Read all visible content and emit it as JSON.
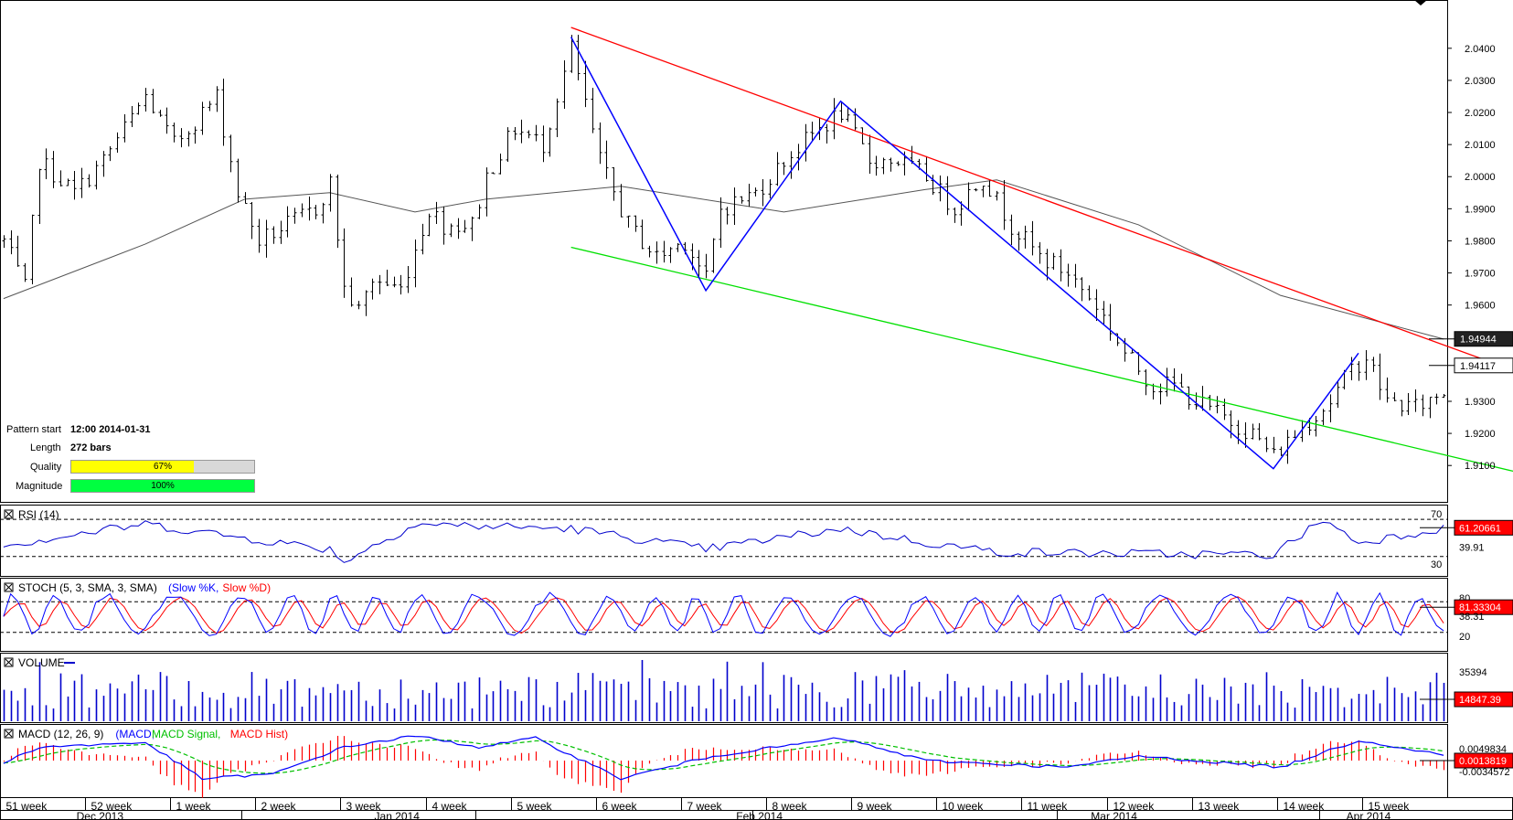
{
  "pattern": {
    "start_label": "Pattern start",
    "start_value": "12:00 2014-01-31",
    "length_label": "Length",
    "length_value": "272 bars",
    "quality_label": "Quality",
    "quality_text": "67%",
    "quality_pct": 67,
    "magnitude_label": "Magnitude",
    "magnitude_text": "100%",
    "magnitude_pct": 100
  },
  "chart_data": {
    "type": "candlestick",
    "price_axis": {
      "ticks": [
        "2.0400",
        "2.0300",
        "2.0200",
        "2.0100",
        "2.0000",
        "1.9900",
        "1.9800",
        "1.9700",
        "1.9600",
        "1.9300",
        "1.9200",
        "1.9100"
      ],
      "ylim": [
        1.9055,
        2.0465
      ],
      "tags": [
        {
          "value": 1.94944,
          "text": "1.94944"
        },
        {
          "value": 1.94117,
          "text": "1.94117"
        }
      ]
    },
    "pattern_lines": [
      {
        "color": "#ff0000",
        "from": [
          80,
          2.0465
        ],
        "to": [
          218,
          1.9355
        ]
      },
      {
        "color": "#00e000",
        "from": [
          80,
          1.978
        ],
        "to": [
          218,
          1.9055
        ]
      }
    ],
    "zigzag": {
      "color": "#0000ff",
      "points": [
        [
          80,
          2.0435
        ],
        [
          99,
          1.9645
        ],
        [
          118,
          2.0235
        ],
        [
          179,
          1.909
        ],
        [
          191,
          1.945
        ]
      ]
    },
    "moving_average": {
      "color": "#555555",
      "points": [
        [
          0,
          1.962
        ],
        [
          20,
          1.979
        ],
        [
          34,
          1.993
        ],
        [
          46,
          1.995
        ],
        [
          58,
          1.989
        ],
        [
          68,
          1.993
        ],
        [
          87,
          1.997
        ],
        [
          110,
          1.989
        ],
        [
          130,
          1.996
        ],
        [
          140,
          1.999
        ],
        [
          160,
          1.985
        ],
        [
          180,
          1.963
        ],
        [
          203,
          1.9494
        ]
      ]
    },
    "rsi": {
      "label": "RSI (14)",
      "levels": [
        70,
        30
      ],
      "tags": [
        {
          "text": "61.20661",
          "highlight": true
        },
        {
          "text": "39.91",
          "highlight": false
        }
      ],
      "anchors": [
        [
          0,
          42
        ],
        [
          20,
          65
        ],
        [
          34,
          50
        ],
        [
          46,
          38
        ],
        [
          48,
          25
        ],
        [
          58,
          65
        ],
        [
          80,
          60
        ],
        [
          99,
          38
        ],
        [
          118,
          60
        ],
        [
          130,
          45
        ],
        [
          140,
          35
        ],
        [
          160,
          33
        ],
        [
          179,
          32
        ],
        [
          186,
          70
        ],
        [
          191,
          45
        ],
        [
          203,
          61
        ]
      ]
    },
    "stoch": {
      "label": "STOCH (5, 3, SMA, 3, SMA)",
      "legend": [
        {
          "text": "Slow %K",
          "color": "#0000ff"
        },
        {
          "text": "Slow %D",
          "color": "#ff0000"
        }
      ],
      "levels": [
        80,
        20
      ],
      "tags": [
        {
          "text": "80",
          "highlight": false
        },
        {
          "text": "81.33304",
          "highlight": true
        },
        {
          "text": "38.31",
          "highlight": false
        },
        {
          "text": "20",
          "highlight": false
        }
      ]
    },
    "volume": {
      "label": "VOLUME",
      "tags": [
        {
          "text": "35394",
          "highlight": false
        },
        {
          "text": "14847.39",
          "highlight": true
        }
      ]
    },
    "macd": {
      "label": "MACD (12, 26, 9)",
      "legend": [
        {
          "text": "MACD",
          "color": "#0000ff"
        },
        {
          "text": "MACD Signal",
          "color": "#00c000"
        },
        {
          "text": "MACD Hist",
          "color": "#ff0000"
        }
      ],
      "tags": [
        {
          "text": "0.0049834",
          "highlight": false
        },
        {
          "text": "0.0013819",
          "highlight": true
        },
        {
          "text": "-0.0034572",
          "highlight": false
        }
      ],
      "anchors": [
        [
          0,
          -0.0005
        ],
        [
          5,
          0.003
        ],
        [
          20,
          0.004
        ],
        [
          28,
          -0.004
        ],
        [
          38,
          -0.003
        ],
        [
          48,
          0.003
        ],
        [
          58,
          0.0055
        ],
        [
          67,
          0.003
        ],
        [
          75,
          0.005
        ],
        [
          87,
          -0.004
        ],
        [
          100,
          0.001
        ],
        [
          118,
          0.005
        ],
        [
          130,
          0.0
        ],
        [
          150,
          -0.0015
        ],
        [
          160,
          0.001
        ],
        [
          180,
          -0.0015
        ],
        [
          191,
          0.0045
        ],
        [
          203,
          0.0013
        ]
      ]
    },
    "x_axis": {
      "week_labels": [
        {
          "label": "51 week",
          "index": 0
        },
        {
          "label": "52 week",
          "index": 12
        },
        {
          "label": "1 week",
          "index": 24
        },
        {
          "label": "2 week",
          "index": 36
        },
        {
          "label": "3 week",
          "index": 48
        },
        {
          "label": "4 week",
          "index": 60
        },
        {
          "label": "5 week",
          "index": 72
        },
        {
          "label": "6 week",
          "index": 84
        },
        {
          "label": "7 week",
          "index": 96
        },
        {
          "label": "8 week",
          "index": 108
        },
        {
          "label": "9 week",
          "index": 120
        },
        {
          "label": "10 week",
          "index": 132
        },
        {
          "label": "11 week",
          "index": 144
        },
        {
          "label": "12 week",
          "index": 156
        },
        {
          "label": "13 week",
          "index": 168
        },
        {
          "label": "14 week",
          "index": 180
        },
        {
          "label": "15 week",
          "index": 192
        }
      ],
      "month_labels": [
        {
          "label": "Dec 2013",
          "index": 14
        },
        {
          "label": "Jan 2014",
          "index": 56
        },
        {
          "label": "Feb 2014",
          "index": 107
        },
        {
          "label": "Mar 2014",
          "index": 157
        },
        {
          "label": "Apr 2014",
          "index": 193
        }
      ]
    },
    "price_anchors": [
      [
        0,
        1.98
      ],
      [
        3,
        1.965
      ],
      [
        5,
        2.005
      ],
      [
        10,
        1.995
      ],
      [
        14,
        2.005
      ],
      [
        20,
        2.025
      ],
      [
        24,
        2.01
      ],
      [
        30,
        2.025
      ],
      [
        33,
        1.995
      ],
      [
        36,
        1.98
      ],
      [
        40,
        1.985
      ],
      [
        44,
        1.99
      ],
      [
        46,
        1.998
      ],
      [
        48,
        1.965
      ],
      [
        50,
        1.958
      ],
      [
        52,
        1.968
      ],
      [
        56,
        1.965
      ],
      [
        60,
        1.99
      ],
      [
        62,
        1.985
      ],
      [
        66,
        1.985
      ],
      [
        68,
        2.0
      ],
      [
        72,
        2.015
      ],
      [
        76,
        2.01
      ],
      [
        80,
        2.04
      ],
      [
        84,
        2.005
      ],
      [
        88,
        1.985
      ],
      [
        92,
        1.975
      ],
      [
        96,
        1.98
      ],
      [
        99,
        1.968
      ],
      [
        101,
        1.99
      ],
      [
        106,
        1.995
      ],
      [
        110,
        2.005
      ],
      [
        115,
        2.015
      ],
      [
        118,
        2.02
      ],
      [
        122,
        2.005
      ],
      [
        126,
        2.005
      ],
      [
        130,
        2.0
      ],
      [
        134,
        1.99
      ],
      [
        138,
        2.0
      ],
      [
        142,
        1.985
      ],
      [
        146,
        1.975
      ],
      [
        150,
        1.97
      ],
      [
        154,
        1.96
      ],
      [
        158,
        1.945
      ],
      [
        162,
        1.935
      ],
      [
        165,
        1.935
      ],
      [
        168,
        1.93
      ],
      [
        172,
        1.925
      ],
      [
        176,
        1.92
      ],
      [
        179,
        1.913
      ],
      [
        183,
        1.922
      ],
      [
        187,
        1.93
      ],
      [
        190,
        1.94
      ],
      [
        192,
        1.944
      ],
      [
        195,
        1.93
      ],
      [
        199,
        1.928
      ],
      [
        203,
        1.933
      ]
    ]
  }
}
